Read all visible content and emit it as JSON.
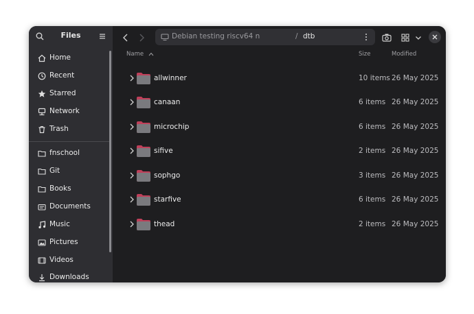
{
  "sidebar": {
    "title": "Files",
    "places": [
      {
        "label": "Home",
        "icon": "home-icon"
      },
      {
        "label": "Recent",
        "icon": "clock-icon"
      },
      {
        "label": "Starred",
        "icon": "star-icon"
      },
      {
        "label": "Network",
        "icon": "network-icon"
      },
      {
        "label": "Trash",
        "icon": "trash-icon"
      }
    ],
    "bookmarks": [
      {
        "label": "fnschool",
        "icon": "folder-icon"
      },
      {
        "label": "Git",
        "icon": "folder-icon"
      },
      {
        "label": "Books",
        "icon": "folder-icon"
      },
      {
        "label": "Documents",
        "icon": "document-icon"
      },
      {
        "label": "Music",
        "icon": "music-icon"
      },
      {
        "label": "Pictures",
        "icon": "picture-icon"
      },
      {
        "label": "Videos",
        "icon": "video-icon"
      },
      {
        "label": "Downloads",
        "icon": "download-icon"
      }
    ]
  },
  "pathbar": {
    "location": "Debian testing riscv64 n",
    "separator": "/",
    "current": "dtb"
  },
  "columns": {
    "name": "Name",
    "size": "Size",
    "modified": "Modified"
  },
  "files": [
    {
      "name": "allwinner",
      "size": "10 items",
      "modified": "26 May 2025"
    },
    {
      "name": "canaan",
      "size": "6 items",
      "modified": "26 May 2025"
    },
    {
      "name": "microchip",
      "size": "6 items",
      "modified": "26 May 2025"
    },
    {
      "name": "sifive",
      "size": "2 items",
      "modified": "26 May 2025"
    },
    {
      "name": "sophgo",
      "size": "3 items",
      "modified": "26 May 2025"
    },
    {
      "name": "starfive",
      "size": "6 items",
      "modified": "26 May 2025"
    },
    {
      "name": "thead",
      "size": "2 items",
      "modified": "26 May 2025"
    }
  ],
  "colors": {
    "window_bg": "#1e1e20",
    "sidebar_bg": "#2e2e32",
    "folder_body": "#7a7a7e",
    "folder_accent": "#c0405a"
  }
}
